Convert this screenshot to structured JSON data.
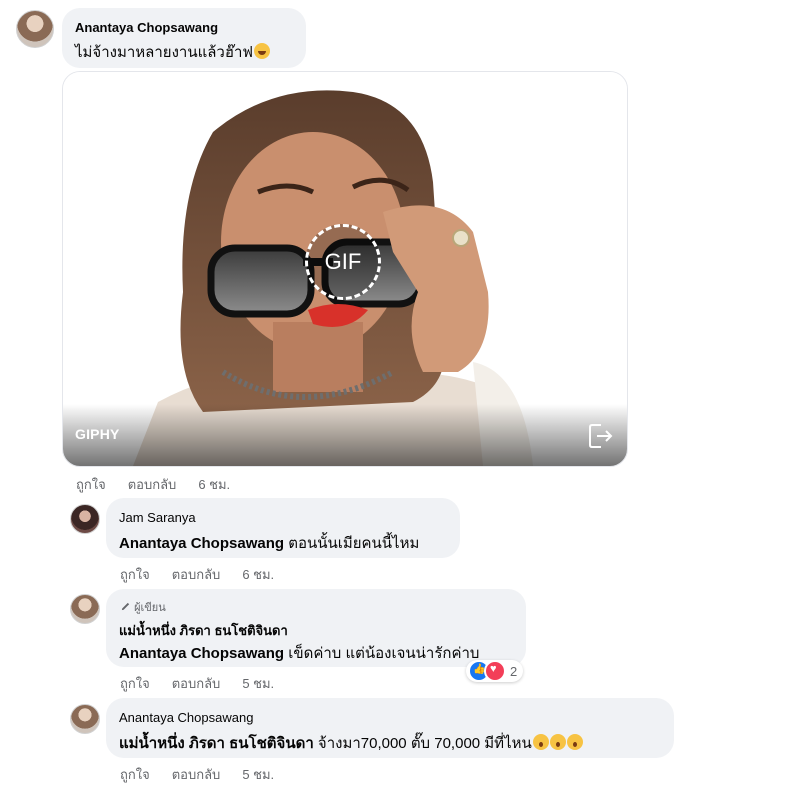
{
  "comments": [
    {
      "author": "Anantaya Chopsawang",
      "text": "ไม่จ้างมาหลายงานแล้วฮ๊าฟ",
      "emoji": "laughing-emoji",
      "gif": {
        "badge": "GIF",
        "provider": "GIPHY",
        "share_icon": "share-icon"
      },
      "actions": {
        "like": "ถูกใจ",
        "reply": "ตอบกลับ",
        "time": "6 ชม."
      }
    },
    {
      "author": "Jam Saranya",
      "tag": "Anantaya Chopsawang",
      "text": "ตอนนั้นเมียคนนี้ไหม",
      "actions": {
        "like": "ถูกใจ",
        "reply": "ตอบกลับ",
        "time": "6 ชม."
      }
    },
    {
      "author_badge": "ผู้เขียน",
      "author": "แม่น้ำหนึ่ง ภิรดา ธนโชติจินดา",
      "tag": "Anantaya Chopsawang",
      "text": "เข็ดค่าบ แต่น้องเจนน่ารักค่าบ",
      "reactions": {
        "icons": [
          "like-reaction-icon",
          "love-reaction-icon"
        ],
        "count": "2"
      },
      "actions": {
        "like": "ถูกใจ",
        "reply": "ตอบกลับ",
        "time": "5 ชม."
      }
    },
    {
      "author": "Anantaya Chopsawang",
      "tag": "แม่น้ำหนึ่ง ภิรดา ธนโชติจินดา",
      "text": "จ้างมา70,000 ตั๊บ 70,000 มีที่ไหน",
      "emoji": "surprised-emoji",
      "actions": {
        "like": "ถูกใจ",
        "reply": "ตอบกลับ",
        "time": "5 ชม."
      }
    }
  ],
  "colors": {
    "bubble": "#f0f2f5",
    "meta": "#65676b",
    "like": "#1877f2",
    "love": "#f33e58"
  }
}
